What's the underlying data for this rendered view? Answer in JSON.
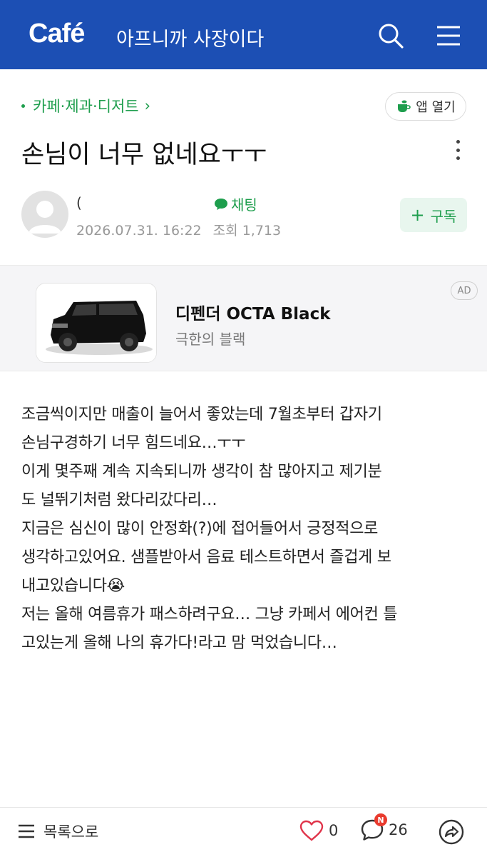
{
  "header": {
    "logo": "Café",
    "cafe_name": "아프니까 사장이다"
  },
  "board": {
    "label": "카페·제과·디저트",
    "chevron": "›"
  },
  "app_open": {
    "label": "앱 열기"
  },
  "post": {
    "title": "손님이 너무 없네요ㅜㅜ",
    "author": {
      "name": "(",
      "chat_label": "채팅",
      "date": "2026.07.31. 16:22",
      "views_label": "조회",
      "views": "1,713"
    },
    "subscribe_label": "구독",
    "body": [
      "조금씩이지만 매출이 늘어서 좋았는데 7월초부터 갑자기",
      "손님구경하기 너무 힘드네요…ㅜㅜ",
      "이게 몇주째 계속 지속되니까 생각이 참 많아지고 제기분",
      "도 널뛰기처럼 왔다리갔다리…",
      "지금은 심신이 많이 안정화(?)에 접어들어서 긍정적으로",
      "생각하고있어요. 샘플받아서 음료 테스트하면서 즐겁게 보",
      "내고있습니다😭",
      "저는 올해 여름휴가 패스하려구요… 그냥 카페서 에어컨 틀",
      "고있는게 올해 나의 휴가다!라고 맘 먹었습니다…"
    ]
  },
  "ad": {
    "title": "디펜더 OCTA Black",
    "subtitle": "극한의 블랙",
    "badge": "AD"
  },
  "footer": {
    "list_label": "목록으로",
    "likes": "0",
    "comments": "26",
    "comment_badge": "N"
  },
  "colors": {
    "header_bg": "#1c4fb4",
    "accent_green": "#1e9e4d",
    "badge_red": "#e93b2e"
  },
  "icons": [
    "search-icon",
    "menu-icon",
    "cup-icon",
    "chat-bubble-icon",
    "kebab-icon",
    "list-icon",
    "heart-icon",
    "comment-icon",
    "share-icon"
  ]
}
